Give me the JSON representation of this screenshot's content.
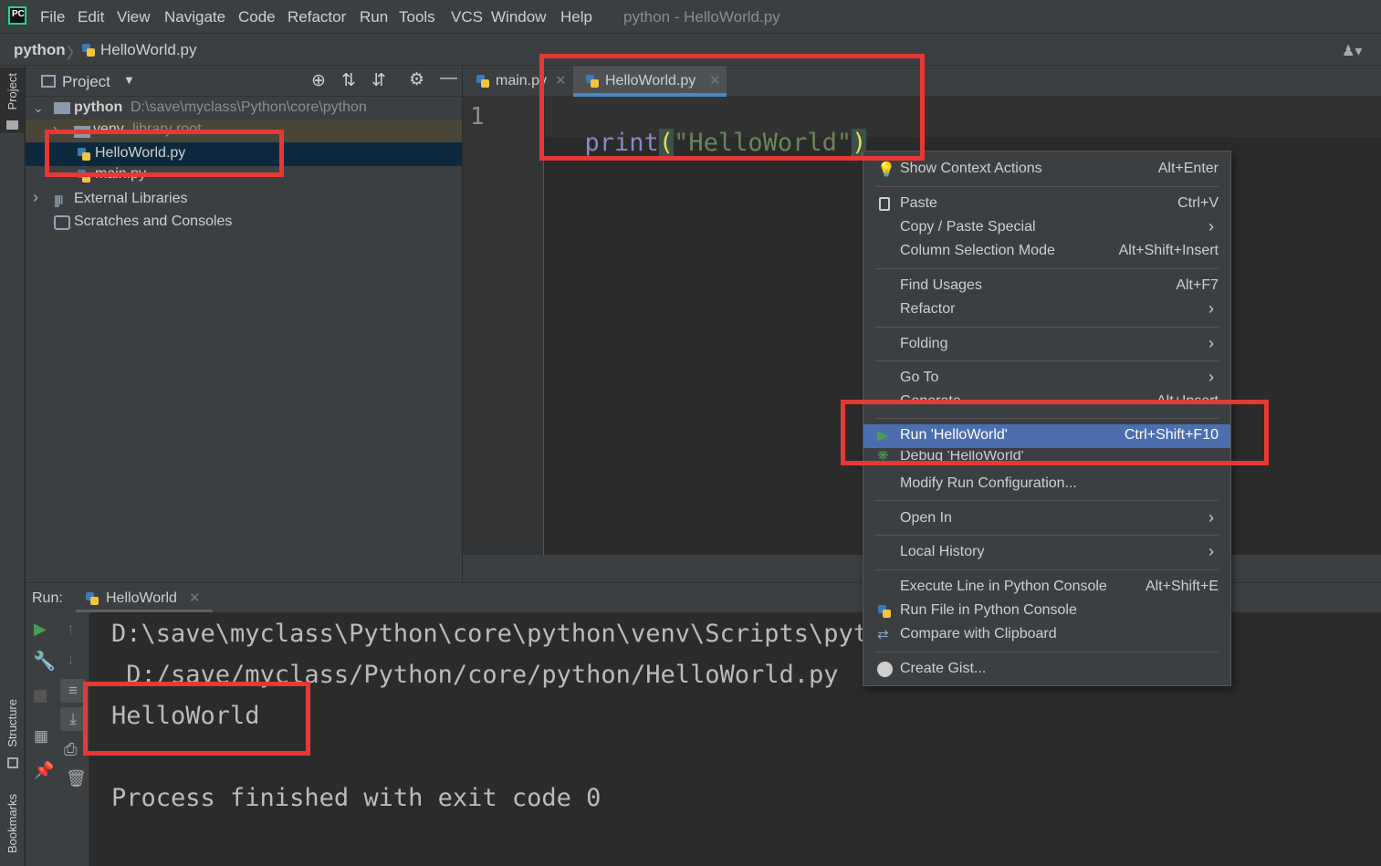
{
  "menubar": {
    "items": [
      "File",
      "Edit",
      "View",
      "Navigate",
      "Code",
      "Refactor",
      "Run",
      "Tools",
      "VCS",
      "Window",
      "Help"
    ],
    "window_title": "python - HelloWorld.py",
    "logo_text": "PC"
  },
  "navbar": {
    "project": "python",
    "separator": "〉",
    "file": "HelloWorld.py"
  },
  "left_stripe": {
    "project_tab": "Project",
    "structure_tab": "Structure",
    "bookmarks_tab": "Bookmarks"
  },
  "project_panel": {
    "title": "Project",
    "tree": {
      "root_name": "python",
      "root_path": "D:\\save\\myclass\\Python\\core\\python",
      "venv": "venv",
      "venv_note": "library root",
      "file_selected": "HelloWorld.py",
      "file_main": "main.py",
      "external_libraries": "External Libraries",
      "scratches": "Scratches and Consoles"
    }
  },
  "editor": {
    "tabs": [
      {
        "label": "main.py",
        "active": false
      },
      {
        "label": "HelloWorld.py",
        "active": true
      }
    ],
    "line_number": "1",
    "code": {
      "func": "print",
      "open_paren": "(",
      "string": "\"HelloWorld\"",
      "close_paren": ")"
    }
  },
  "run_panel": {
    "label": "Run:",
    "tab": "HelloWorld",
    "console": {
      "line1": "D:\\save\\myclass\\Python\\core\\python\\venv\\Scripts\\python.exe",
      "line2": " D:/save/myclass/Python/core/python/HelloWorld.py",
      "output": "HelloWorld",
      "finish": "Process finished with exit code 0"
    }
  },
  "context_menu": {
    "items": [
      {
        "label": "Show Context Actions",
        "shortcut": "Alt+Enter"
      },
      {
        "label": "Paste",
        "shortcut": "Ctrl+V"
      },
      {
        "label": "Copy / Paste Special",
        "shortcut": "›"
      },
      {
        "label": "Column Selection Mode",
        "shortcut": "Alt+Shift+Insert"
      },
      {
        "label": "Find Usages",
        "shortcut": "Alt+F7"
      },
      {
        "label": "Refactor",
        "shortcut": "›"
      },
      {
        "label": "Folding",
        "shortcut": "›"
      },
      {
        "label": "Go To",
        "shortcut": "›"
      },
      {
        "label": "Generate...",
        "shortcut": "Alt+Insert"
      },
      {
        "label": "Run 'HelloWorld'",
        "shortcut": "Ctrl+Shift+F10"
      },
      {
        "label": "Debug 'HelloWorld'",
        "shortcut": ""
      },
      {
        "label": "Modify Run Configuration...",
        "shortcut": ""
      },
      {
        "label": "Open In",
        "shortcut": "›"
      },
      {
        "label": "Local History",
        "shortcut": "›"
      },
      {
        "label": "Execute Line in Python Console",
        "shortcut": "Alt+Shift+E"
      },
      {
        "label": "Run File in Python Console",
        "shortcut": ""
      },
      {
        "label": "Compare with Clipboard",
        "shortcut": ""
      },
      {
        "label": "Create Gist...",
        "shortcut": ""
      }
    ]
  },
  "colors": {
    "annotation": "#e53935",
    "highlight": "#4b6eaf",
    "code_function": "#8888c6",
    "code_string": "#6a8759",
    "paren_match": "#e0e04a"
  }
}
